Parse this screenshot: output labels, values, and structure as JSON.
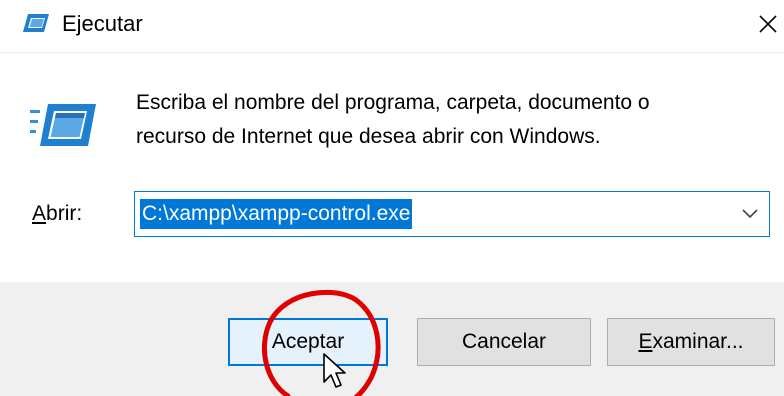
{
  "window": {
    "title": "Ejecutar",
    "title_icon": "run-dialog-icon",
    "close_glyph": "✕"
  },
  "content": {
    "icon": "run-program-icon",
    "description_line1": "Escriba el nombre del programa, carpeta, documento o",
    "description_line2": "recurso de Internet que desea abrir con Windows.",
    "open_label_first": "A",
    "open_label_rest": "brir:",
    "open_value": "C:\\xampp\\xampp-control.exe",
    "dropdown_icon": "chevron-down-icon"
  },
  "buttons": {
    "accept": "Aceptar",
    "cancel": "Cancelar",
    "browse_first": "E",
    "browse_rest": "xaminar..."
  },
  "colors": {
    "accent": "#0078d7",
    "annotation": "#e00000",
    "footer_bg": "#f0f0f0"
  }
}
